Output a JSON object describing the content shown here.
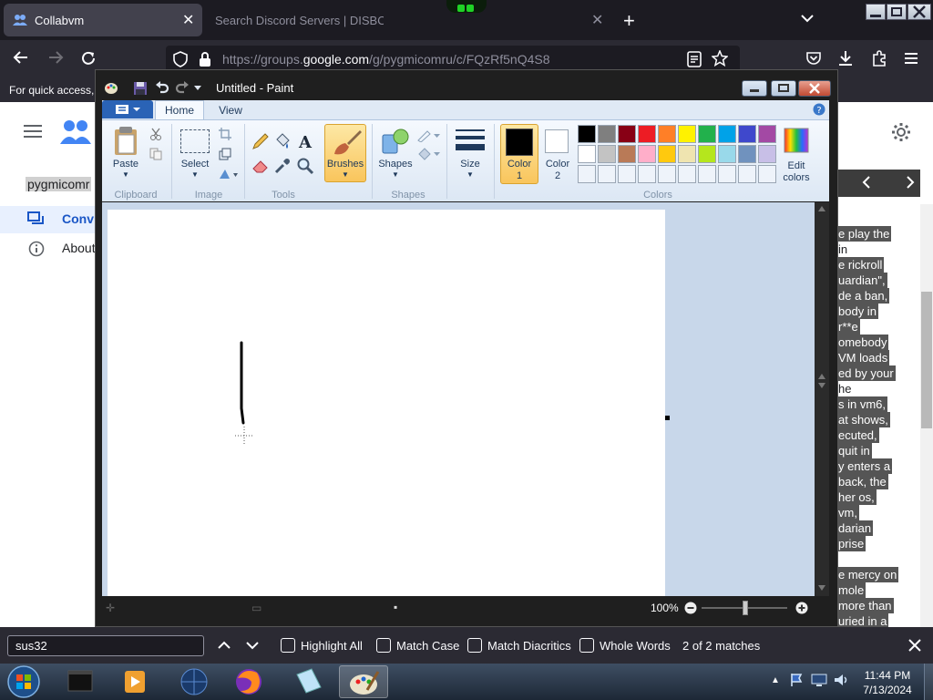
{
  "browser": {
    "tabs": [
      {
        "title": "Collabvm",
        "active": true
      },
      {
        "title": "Search Discord Servers | DISBOARD",
        "active": false
      }
    ],
    "url_prefix": "https://groups.",
    "url_domain": "google.com",
    "url_suffix": "/g/pygmicomru/c/FQzRf5nQ4S8",
    "bookmarks_text": "For quick access,"
  },
  "groups_page": {
    "group_name": "pygmicomr",
    "nav_conversations": "Conv",
    "nav_about": "About",
    "right_lines": [
      "e play the",
      "in",
      "e rickroll",
      "uardian\",",
      "de a ban,",
      "body in",
      "r**e",
      "omebody",
      "VM loads",
      "ed by your",
      "he",
      "s in vm6,",
      "at shows,",
      "ecuted,",
      "quit in",
      "y enters a",
      "back, the",
      "her os,",
      "vm,",
      "darian",
      "prise",
      "",
      "e mercy on",
      "mole",
      "more than",
      "uried in a"
    ],
    "highlight_lines": [
      0,
      2,
      3,
      4,
      5,
      6,
      7,
      8,
      9,
      11,
      12,
      13,
      14,
      15,
      16,
      17,
      18,
      19,
      20,
      22,
      23,
      24,
      25
    ]
  },
  "paint": {
    "title": "Untitled - Paint",
    "tabs": {
      "home": "Home",
      "view": "View"
    },
    "groups": {
      "clipboard": "Clipboard",
      "image": "Image",
      "tools": "Tools",
      "shapes": "Shapes",
      "colors": "Colors"
    },
    "buttons": {
      "paste": "Paste",
      "select": "Select",
      "brushes": "Brushes",
      "shapes": "Shapes",
      "size": "Size",
      "color1_line1": "Color",
      "color1_line2": "1",
      "color2_line1": "Color",
      "color2_line2": "2",
      "edit_colors_line1": "Edit",
      "edit_colors_line2": "colors"
    },
    "palette_row1": [
      "#000000",
      "#7f7f7f",
      "#880015",
      "#ed1c24",
      "#ff7f27",
      "#fff200",
      "#22b14c",
      "#00a2e8",
      "#3f48cc",
      "#a349a4"
    ],
    "palette_row2": [
      "#ffffff",
      "#c3c3c3",
      "#b97a57",
      "#ffaec9",
      "#ffc90e",
      "#efe4b0",
      "#b5e61d",
      "#99d9ea",
      "#7092be",
      "#c8bfe7"
    ],
    "color1": "#000000",
    "color2": "#ffffff",
    "zoom": "100%"
  },
  "findbar": {
    "query": "sus32",
    "highlight_all": "Highlight All",
    "match_case": "Match Case",
    "match_diacritics": "Match Diacritics",
    "whole_words": "Whole Words",
    "match_count": "2 of 2 matches"
  },
  "taskbar": {
    "time": "11:44 PM",
    "date": "7/13/2024"
  }
}
